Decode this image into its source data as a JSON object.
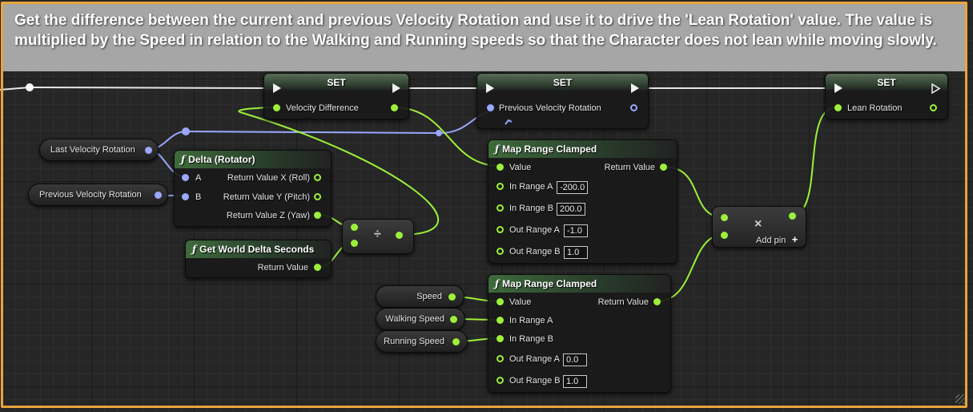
{
  "comment": {
    "text": "Get the difference between the current and previous Velocity Rotation and use it to drive the 'Lean Rotation' value. The value is multiplied by the Speed in relation to the Walking and Running speeds so that the Character does not lean while moving slowly.",
    "color": "#e8a43a"
  },
  "colors": {
    "float_pin": "#9cf03a",
    "rotator_pin": "#9aa8ff",
    "exec_pin": "#f2f2f2"
  },
  "nodes": {
    "set1": {
      "title": "SET",
      "pin": "Velocity Difference"
    },
    "set2": {
      "title": "SET",
      "pin": "Previous Velocity Rotation"
    },
    "set3": {
      "title": "SET",
      "pin": "Lean Rotation"
    },
    "get_last_velocity_rotation": {
      "label": "Last Velocity Rotation"
    },
    "get_previous_velocity_rotation": {
      "label": "Previous Velocity Rotation"
    },
    "delta_rotator": {
      "title": "Delta (Rotator)",
      "input_a": "A",
      "input_b": "B",
      "out_x": "Return Value X (Roll)",
      "out_y": "Return Value Y (Pitch)",
      "out_z": "Return Value Z (Yaw)"
    },
    "get_world_delta_seconds": {
      "title": "Get World Delta Seconds",
      "out": "Return Value"
    },
    "divide": {
      "glyph": "÷"
    },
    "map_range_1": {
      "title": "Map Range Clamped",
      "value": "Value",
      "in_range_a": "In Range A",
      "in_range_a_val": "-200.0",
      "in_range_b": "In Range B",
      "in_range_b_val": "200.0",
      "out_range_a": "Out Range A",
      "out_range_a_val": "-1.0",
      "out_range_b": "Out Range B",
      "out_range_b_val": "1.0",
      "return_value": "Return Value"
    },
    "map_range_2": {
      "title": "Map Range Clamped",
      "value": "Value",
      "in_range_a": "In Range A",
      "in_range_b": "In Range B",
      "out_range_a": "Out Range A",
      "out_range_a_val": "0.0",
      "out_range_b": "Out Range B",
      "out_range_b_val": "1.0",
      "return_value": "Return Value"
    },
    "get_speed": {
      "label": "Speed"
    },
    "get_walking_speed": {
      "label": "Walking Speed"
    },
    "get_running_speed": {
      "label": "Running Speed"
    },
    "multiply": {
      "glyph": "×",
      "add_pin": "Add pin",
      "add_glyph": "+"
    }
  }
}
